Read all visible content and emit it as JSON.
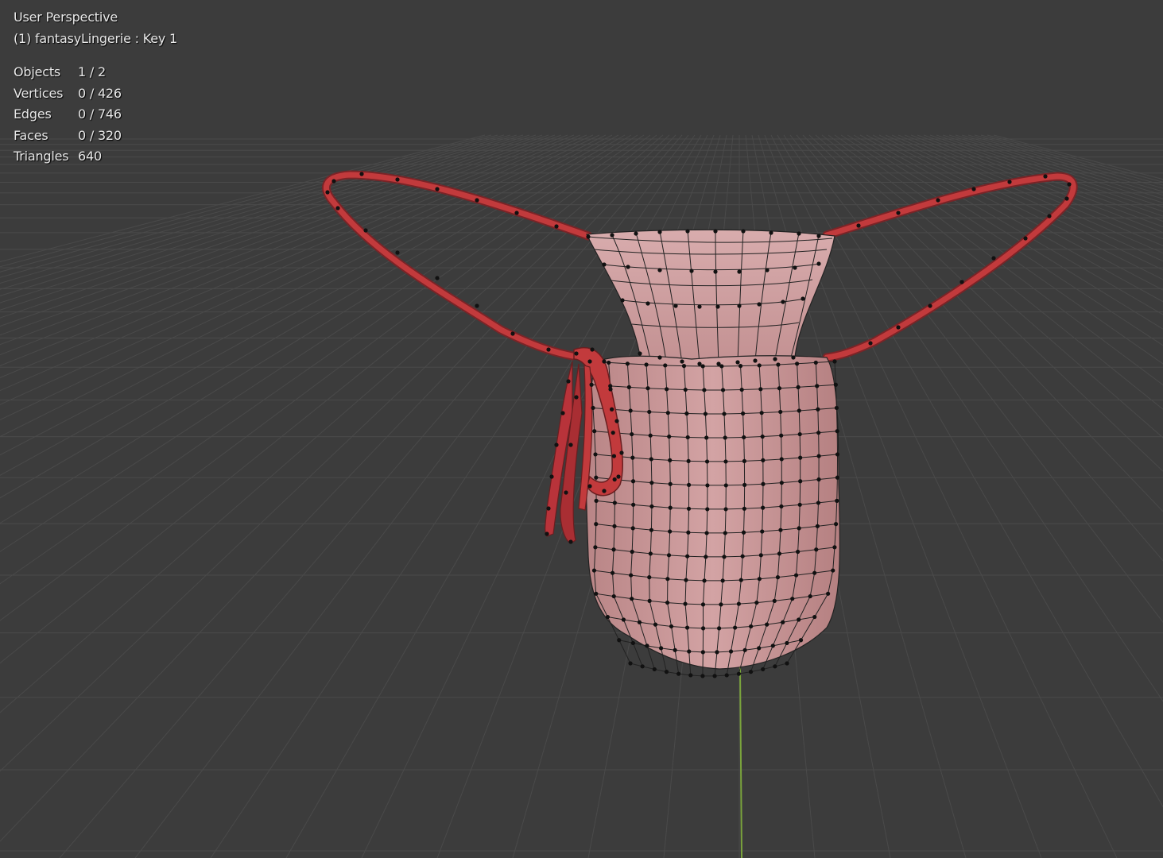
{
  "viewport": {
    "view_name": "User Perspective",
    "object_info": "(1) fantasyLingerie : Key 1"
  },
  "stats": [
    {
      "label": "Objects",
      "value": "1 / 2"
    },
    {
      "label": "Vertices",
      "value": "0 / 426"
    },
    {
      "label": "Edges",
      "value": "0 / 746"
    },
    {
      "label": "Faces",
      "value": "0 / 320"
    },
    {
      "label": "Triangles",
      "value": "640"
    }
  ],
  "colors": {
    "background": "#3c3c3c",
    "grid": "#4a4a4a",
    "y_axis": "#7aa33c",
    "body_mesh": "#c99697",
    "strap_mesh": "#c23a3c",
    "vertex": "#111111"
  }
}
